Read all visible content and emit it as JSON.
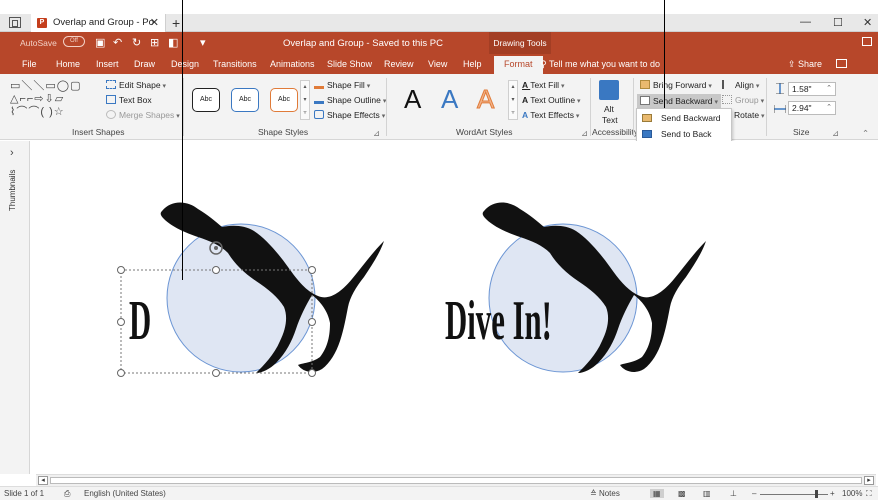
{
  "browser": {
    "tab_title": "Overlap and Group - Po",
    "tab_close": "✕",
    "new_tab": "+",
    "minimize": "—",
    "maximize": "☐",
    "close": "✕"
  },
  "titlebar": {
    "autosave_label": "AutoSave",
    "autosave_state": "Off",
    "document_title": "Overlap and Group  -  Saved to this PC",
    "contextual_tab_group": "Drawing Tools",
    "accent_color": "#b7472a"
  },
  "menu": {
    "tabs": [
      "File",
      "Home",
      "Insert",
      "Draw",
      "Design",
      "Transitions",
      "Animations",
      "Slide Show",
      "Review",
      "View",
      "Help",
      "Format"
    ],
    "active_tab": "Format",
    "tell_me": "Tell me what you want to do",
    "share": "Share"
  },
  "ribbon": {
    "insert_shapes": {
      "label": "Insert Shapes",
      "edit_shape": "Edit Shape",
      "text_box": "Text Box",
      "merge_shapes": "Merge Shapes"
    },
    "shape_styles": {
      "label": "Shape Styles",
      "preset_text": "Abc",
      "shape_fill": "Shape Fill",
      "shape_outline": "Shape Outline",
      "shape_effects": "Shape Effects"
    },
    "wordart_styles": {
      "label": "WordArt Styles",
      "letter": "A",
      "text_fill": "Text Fill",
      "text_outline": "Text Outline",
      "text_effects": "Text Effects"
    },
    "accessibility": {
      "label": "Accessibility",
      "alt_text_line1": "Alt",
      "alt_text_line2": "Text"
    },
    "arrange": {
      "bring_forward": "Bring Forward",
      "send_backward": "Send Backward",
      "align": "Align",
      "group": "Group",
      "rotate": "Rotate"
    },
    "size": {
      "label": "Size",
      "height": "1.58\"",
      "width": "2.94\""
    }
  },
  "dropdown": {
    "items": [
      "Send Backward",
      "Send to Back"
    ]
  },
  "thumbnails": {
    "label": "Thumbnails",
    "chevron": "›"
  },
  "slide": {
    "left_text": "D",
    "right_text": "Dive In!"
  },
  "statusbar": {
    "slide_info": "Slide 1 of 1",
    "language": "English (United States)",
    "notes": "Notes",
    "zoom_minus": "–",
    "zoom_plus": "+",
    "zoom_level": "100%"
  }
}
